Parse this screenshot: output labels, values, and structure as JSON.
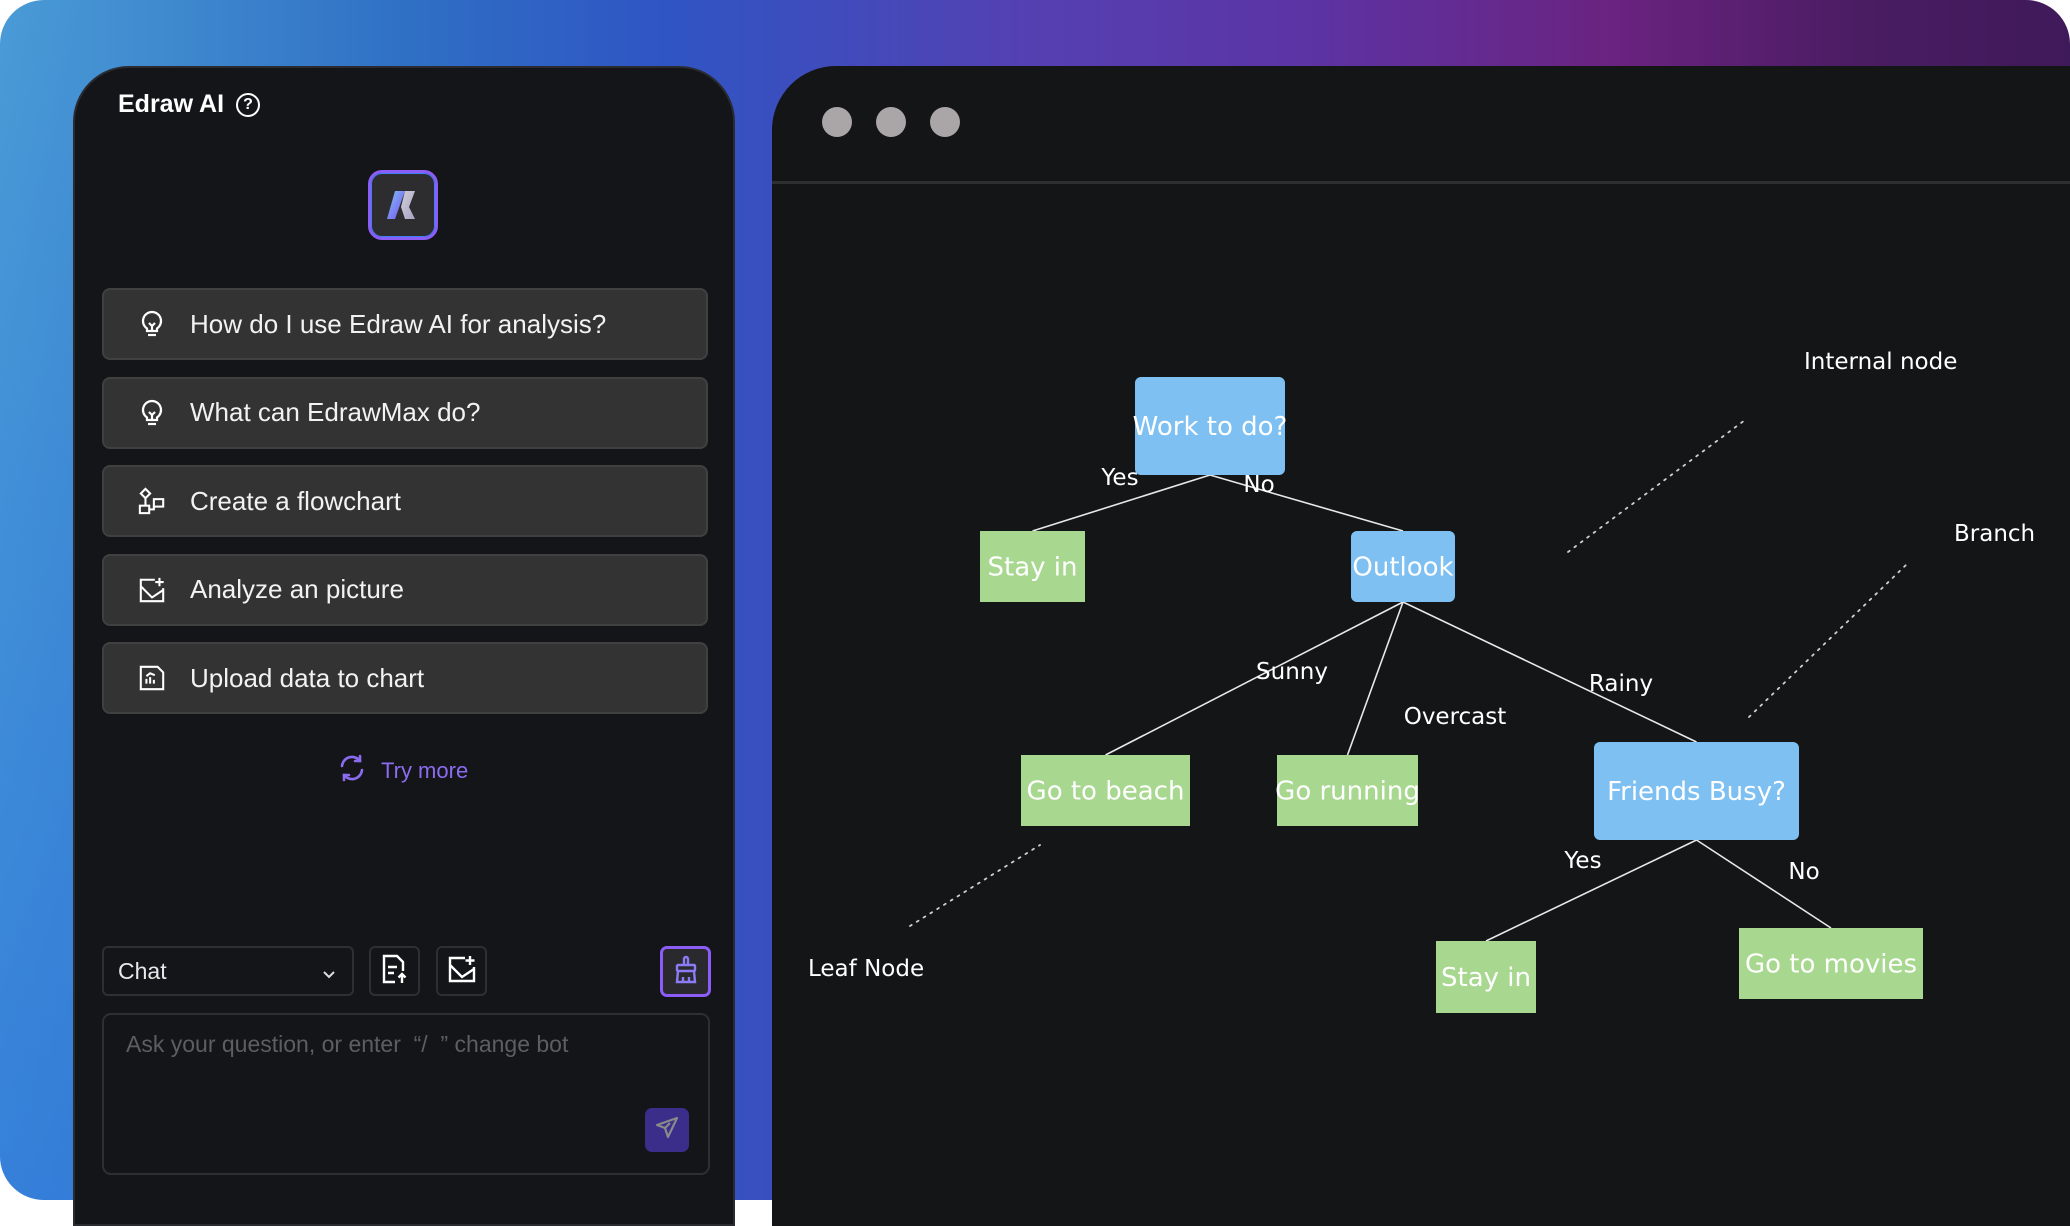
{
  "chat_panel": {
    "title": "Edraw AI",
    "help_icon": "question-circle-icon",
    "logo_icon": "edraw-ai-logo-icon",
    "suggestions": [
      {
        "icon": "lightbulb-icon",
        "label": "How do I use Edraw AI for analysis?"
      },
      {
        "icon": "lightbulb-icon",
        "label": "What can EdrawMax do?"
      },
      {
        "icon": "flowchart-icon",
        "label": "Create a flowchart"
      },
      {
        "icon": "image-add-icon",
        "label": "Analyze an picture"
      },
      {
        "icon": "chart-file-icon",
        "label": "Upload data to chart"
      }
    ],
    "try_more": {
      "icon": "refresh-icon",
      "label": "Try more"
    },
    "mode_select": {
      "value": "Chat",
      "icon": "chevron-down-icon"
    },
    "toolbar_buttons": [
      {
        "icon": "file-upload-icon"
      },
      {
        "icon": "image-add-icon"
      }
    ],
    "clear_button": {
      "icon": "broom-icon"
    },
    "input": {
      "value": "",
      "placeholder": "Ask your question, or enter  “/  ” change bot"
    },
    "send_button": {
      "icon": "send-icon"
    }
  },
  "colors": {
    "accent_purple": "#8b5cf6",
    "try_more": "#8b6cf0",
    "decision_node": "#7ec0f2",
    "leaf_node": "#a8d88f",
    "panel_bg": "#141518",
    "suggestion_bg": "#333333",
    "window_dot": "#aaa6a7"
  },
  "diagram_window": {
    "window_controls": [
      "window-dot-1",
      "window-dot-2",
      "window-dot-3"
    ],
    "decision_tree": {
      "nodes": [
        {
          "id": "work",
          "label": "Work to do?",
          "type": "decision"
        },
        {
          "id": "stay1",
          "label": "Stay in",
          "type": "leaf"
        },
        {
          "id": "outlook",
          "label": "Outlook",
          "type": "decision"
        },
        {
          "id": "beach",
          "label": "Go to beach",
          "type": "leaf"
        },
        {
          "id": "running",
          "label": "Go running",
          "type": "leaf"
        },
        {
          "id": "friends",
          "label": "Friends Busy?",
          "type": "decision"
        },
        {
          "id": "stay2",
          "label": "Stay in",
          "type": "leaf"
        },
        {
          "id": "movies",
          "label": "Go to movies",
          "type": "leaf"
        }
      ],
      "edges": [
        {
          "from": "work",
          "to": "stay1",
          "label": "Yes"
        },
        {
          "from": "work",
          "to": "outlook",
          "label": "No"
        },
        {
          "from": "outlook",
          "to": "beach",
          "label": "Sunny"
        },
        {
          "from": "outlook",
          "to": "running",
          "label": "Overcast"
        },
        {
          "from": "outlook",
          "to": "friends",
          "label": "Rainy"
        },
        {
          "from": "friends",
          "to": "stay2",
          "label": "Yes"
        },
        {
          "from": "friends",
          "to": "movies",
          "label": "No"
        }
      ],
      "annotations": [
        {
          "label": "Internal node",
          "points_to": "outlook"
        },
        {
          "label": "Branch",
          "points_to": "rainy-edge"
        },
        {
          "label": "Leaf Node",
          "points_to": "beach"
        }
      ]
    }
  }
}
